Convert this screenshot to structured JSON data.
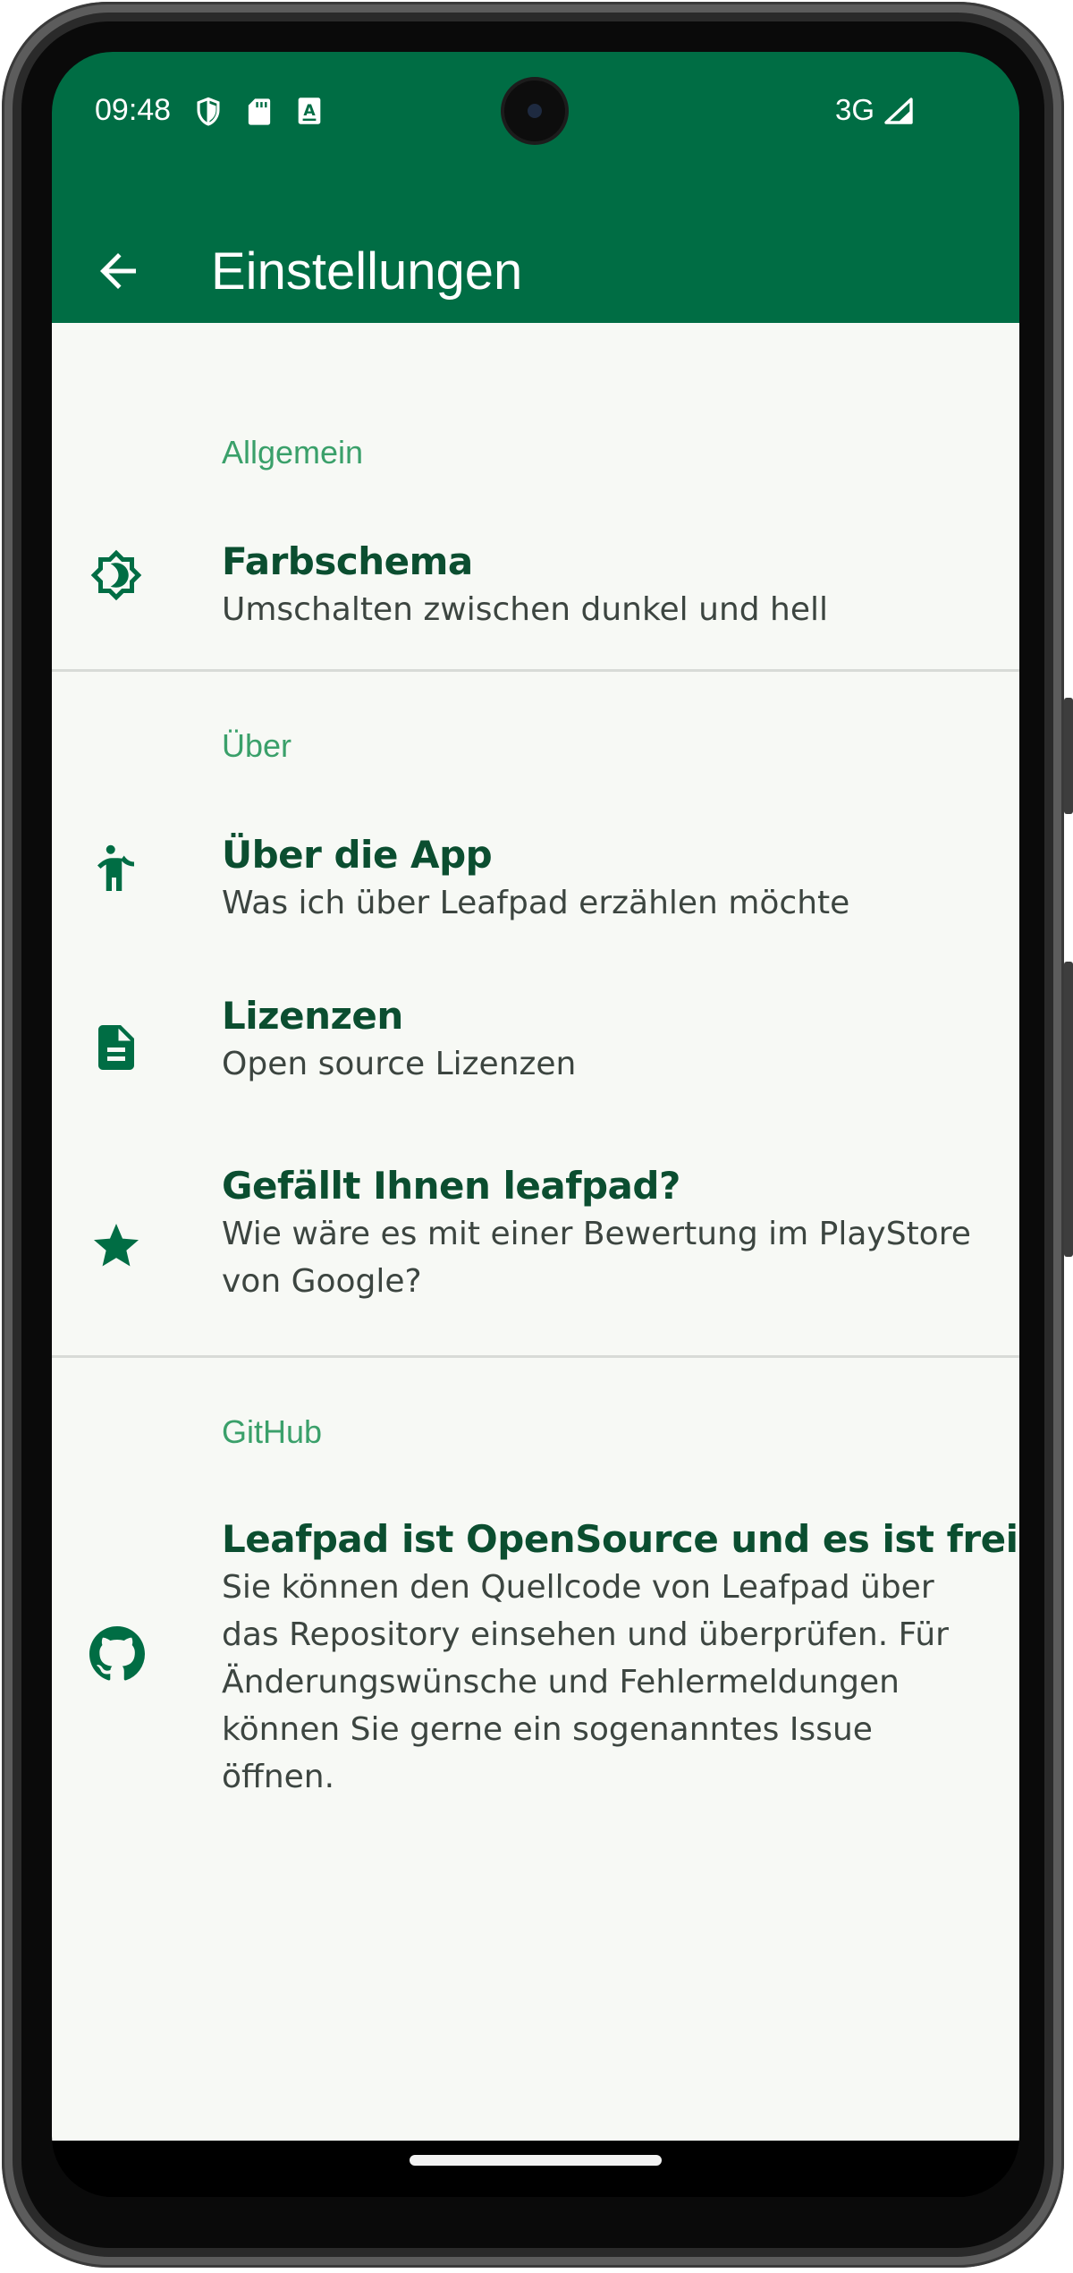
{
  "status_bar": {
    "time": "09:48",
    "icons": [
      "shield-icon",
      "sd-card-icon",
      "keyboard-icon"
    ],
    "network": "3G",
    "signal_icon": "signal-icon"
  },
  "app_bar": {
    "title": "Einstellungen",
    "back_icon": "arrow-back-icon"
  },
  "sections": {
    "general": {
      "header": "Allgemein",
      "items": [
        {
          "icon": "brightness-icon",
          "title": "Farbschema",
          "summary": "Umschalten zwischen dunkel und hell"
        }
      ]
    },
    "about": {
      "header": "Über",
      "items": [
        {
          "icon": "person-icon",
          "title": "Über die App",
          "summary": "Was ich über Leafpad erzählen möchte"
        },
        {
          "icon": "document-icon",
          "title": "Lizenzen",
          "summary": "Open source Lizenzen"
        },
        {
          "icon": "star-icon",
          "title": "Gefällt Ihnen leafpad?",
          "summary": "Wie wäre es mit einer Bewertung im PlayStore von Google?"
        }
      ]
    },
    "github": {
      "header": "GitHub",
      "items": [
        {
          "icon": "github-icon",
          "title": "Leafpad ist OpenSource und es ist frei",
          "summary": "Sie können den Quellcode von Leafpad über das Repository einsehen und überprüfen. Für Änderungswünsche und Fehlermeldungen können Sie gerne ein sogenanntes Issue öffnen."
        }
      ]
    }
  },
  "colors": {
    "primary": "#006d44",
    "section_header": "#3aa06a",
    "title_text": "#0b4e30",
    "background": "#f7f9f5"
  }
}
